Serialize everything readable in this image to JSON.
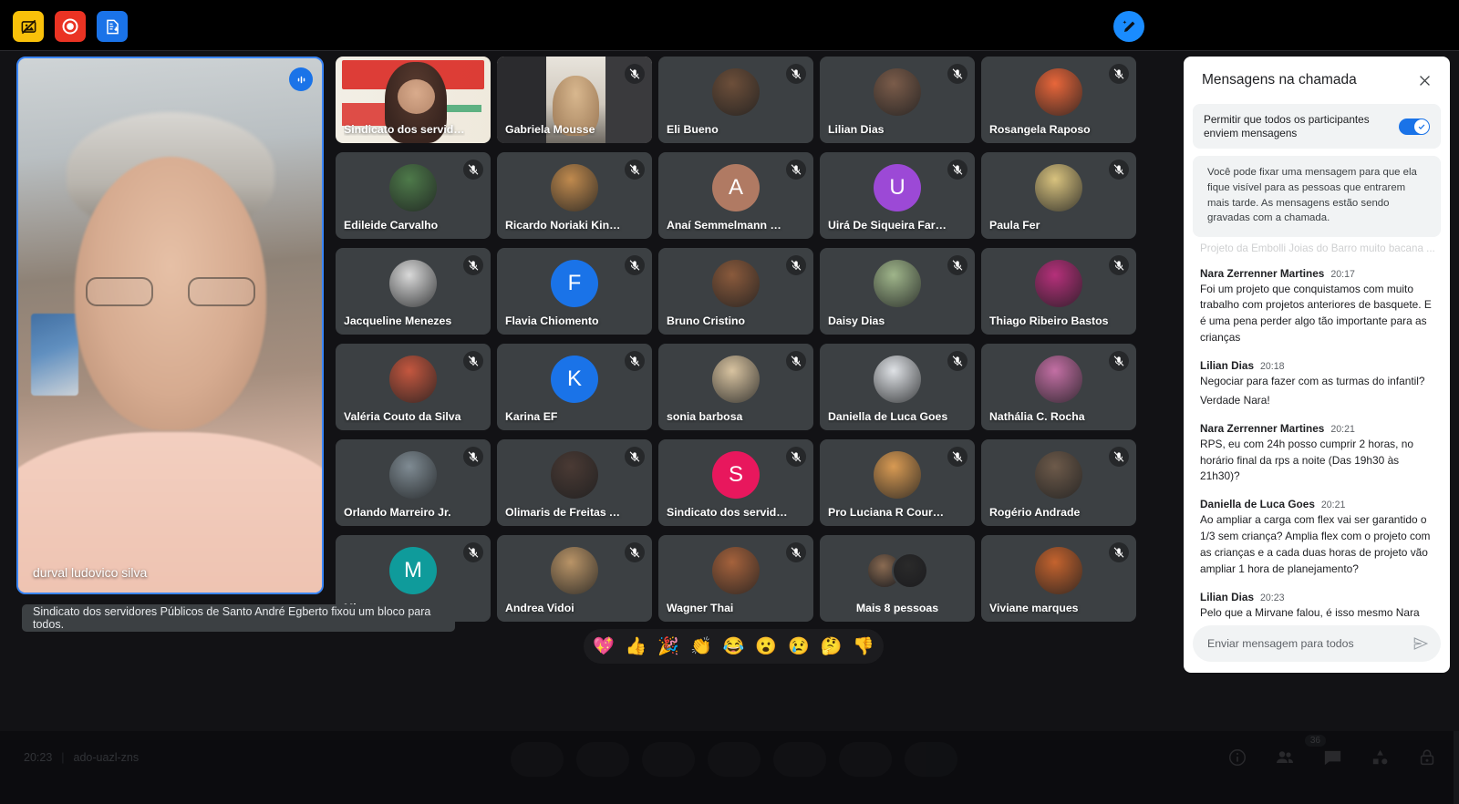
{
  "app": {
    "title": "Google Meet call",
    "accent_blue": "#1a73e8",
    "tile_bg": "#3c4043"
  },
  "toolbar": {
    "buttons": [
      {
        "name": "screenshot-blocker-extension",
        "icon": "image-blocked-icon",
        "color": "#f9c10a"
      },
      {
        "name": "record-extension",
        "icon": "record-circle-icon",
        "color": "#ea3323"
      },
      {
        "name": "transcript-extension",
        "icon": "document-download-icon",
        "color": "#1a73e8"
      }
    ],
    "ai_button": {
      "name": "ai-assist-button",
      "icon": "magic-pencil-icon",
      "color": "#1a8cff"
    }
  },
  "selfview": {
    "name": "durval ludovico silva",
    "audio_icon": "audio-waveform-icon"
  },
  "pin_toast": {
    "text": "Sindicato dos servidores Públicos de Santo André Egberto fixou um bloco para todos."
  },
  "participants": [
    {
      "name": "Sindicato dos servidore...",
      "type": "video",
      "muted": false,
      "video_style": "banner"
    },
    {
      "name": "Gabriela Mousse",
      "type": "video",
      "muted": true,
      "video_style": "room"
    },
    {
      "name": "Eli Bueno",
      "type": "photo",
      "muted": true,
      "photo": "#6d4f3a"
    },
    {
      "name": "Lilian Dias",
      "type": "photo",
      "muted": true,
      "photo": "#7b5c4a"
    },
    {
      "name": "Rosangela Raposo",
      "type": "photo",
      "muted": true,
      "photo": "#e8663a"
    },
    {
      "name": "Edileide Carvalho",
      "type": "photo",
      "muted": true,
      "photo": "#4e7a4a"
    },
    {
      "name": "Ricardo Noriaki Kinoshta",
      "type": "photo",
      "muted": true,
      "photo": "#c08a4e"
    },
    {
      "name": "Anaí Semmelmann Oelli...",
      "type": "initial",
      "initial": "A",
      "muted": true,
      "color": "#b07a63"
    },
    {
      "name": "Uirá De Siqueira Farias",
      "type": "initial",
      "initial": "U",
      "muted": true,
      "color": "#9c49d6"
    },
    {
      "name": "Paula Fer",
      "type": "photo",
      "muted": true,
      "photo": "#d8c27e"
    },
    {
      "name": "Jacqueline Menezes",
      "type": "photo",
      "muted": true,
      "photo": "#d9d9d9"
    },
    {
      "name": "Flavia Chiomento",
      "type": "initial",
      "initial": "F",
      "muted": true,
      "color": "#1a73e8"
    },
    {
      "name": "Bruno Cristino",
      "type": "photo",
      "muted": true,
      "photo": "#8a5a3c"
    },
    {
      "name": "Daisy Dias",
      "type": "photo",
      "muted": true,
      "photo": "#9fb58a"
    },
    {
      "name": "Thiago Ribeiro Bastos",
      "type": "photo",
      "muted": true,
      "photo": "#b5307a"
    },
    {
      "name": "Valéria Couto da Silva",
      "type": "photo",
      "muted": true,
      "photo": "#c4573f"
    },
    {
      "name": "Karina EF",
      "type": "initial",
      "initial": "K",
      "muted": true,
      "color": "#1a73e8"
    },
    {
      "name": "sonia barbosa",
      "type": "photo",
      "muted": true,
      "photo": "#d8c3a0"
    },
    {
      "name": "Daniella de Luca Goes",
      "type": "photo",
      "muted": true,
      "photo": "#dfe2e6"
    },
    {
      "name": "Nathália C. Rocha",
      "type": "photo",
      "muted": true,
      "photo": "#c36fa4"
    },
    {
      "name": "Orlando Marreiro Jr.",
      "type": "photo",
      "muted": true,
      "photo": "#7f8b93"
    },
    {
      "name": "Olimaris de Freitas Anto...",
      "type": "photo",
      "muted": true,
      "photo": "#4a3a34"
    },
    {
      "name": "Sindicato dos servidore...",
      "type": "initial",
      "initial": "S",
      "muted": true,
      "color": "#e8175d"
    },
    {
      "name": "Pro Luciana R Courbelly",
      "type": "photo",
      "muted": true,
      "photo": "#d89a53"
    },
    {
      "name": "Rogério Andrade",
      "type": "photo",
      "muted": true,
      "photo": "#6d5a4a"
    },
    {
      "name": "Mirvane",
      "type": "initial",
      "initial": "M",
      "muted": true,
      "color": "#0f9b9b"
    },
    {
      "name": "Andrea Vidoi",
      "type": "photo",
      "muted": true,
      "photo": "#b99467"
    },
    {
      "name": "Wagner Thai",
      "type": "photo",
      "muted": true,
      "photo": "#a5623c"
    },
    {
      "name": "Mais 8 pessoas",
      "type": "multi",
      "muted": false,
      "photos": [
        "#8a6b52",
        "#2a2a2a"
      ]
    },
    {
      "name": "Viviane marques",
      "type": "photo",
      "muted": true,
      "photo": "#c4632e"
    }
  ],
  "reactions": [
    "💖",
    "👍",
    "🎉",
    "👏",
    "😂",
    "😮",
    "😢",
    "🤔",
    "👎"
  ],
  "chat": {
    "title": "Mensagens na chamada",
    "close_icon": "close-icon",
    "allow_toggle": {
      "label": "Permitir que todos os participantes enviem mensagens",
      "enabled": true
    },
    "notice": "Você pode fixar uma mensagem para que ela fique visível para as pessoas que entrarem mais tarde. As mensagens estão sendo gravadas com a chamada.",
    "faded_message": "Projeto da Embolli Joias do Barro muito bacana ...",
    "messages": [
      {
        "author": "Nara Zerrenner Martines",
        "time": "20:17",
        "lines": [
          "Foi um projeto que conquistamos com muito trabalho com projetos anteriores de basquete.  E é uma pena perder algo tão importante para as crianças"
        ]
      },
      {
        "author": "Lilian Dias",
        "time": "20:18",
        "lines": [
          "Negociar para fazer com as turmas do infantil?",
          "Verdade Nara!"
        ]
      },
      {
        "author": "Nara Zerrenner Martines",
        "time": "20:21",
        "lines": [
          "RPS, eu com 24h posso cumprir 2 horas, no horário final da rps a noite (Das 19h30 às 21h30)?"
        ]
      },
      {
        "author": "Daniella de Luca Goes",
        "time": "20:21",
        "lines": [
          "Ao ampliar a carga com flex vai ser garantido o 1/3 sem criança? Amplia flex com o projeto com as crianças e a cada duas horas de projeto vão ampliar 1 hora de planejamento?"
        ]
      },
      {
        "author": "Lilian Dias",
        "time": "20:23",
        "lines": [
          "Pelo que a Mirvane falou, é isso mesmo Nara"
        ]
      }
    ],
    "compose_placeholder": "Enviar mensagem para todos",
    "send_icon": "send-icon"
  },
  "bottom_bar": {
    "time": "20:23",
    "separator": "|",
    "meeting_code": "ado-uazl-zns",
    "people_count": "36",
    "icons": [
      "info-icon",
      "people-icon",
      "chat-icon",
      "activities-icon",
      "lock-icon"
    ]
  }
}
